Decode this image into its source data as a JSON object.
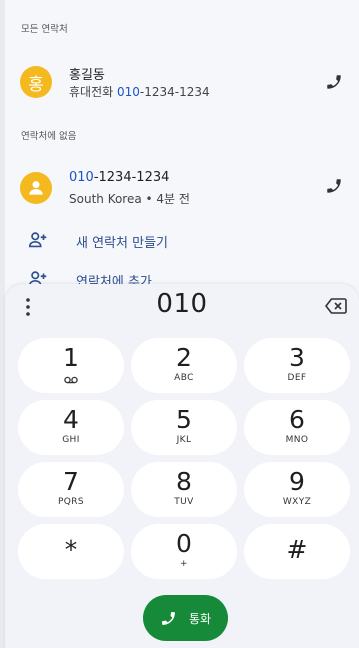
{
  "results": {
    "all_contacts_label": "모든 연락처",
    "contact": {
      "avatar_initial": "홍",
      "name": "홍길동",
      "phone_type": "휴대전화",
      "phone_match": "010",
      "phone_rest": "-1234-1234"
    },
    "not_in_contacts_label": "연락처에 없음",
    "unknown": {
      "number_match": "010",
      "number_rest": "-1234-1234",
      "detail": "South Korea • 4분 전"
    },
    "create_contact_label": "새 연락처 만들기",
    "add_to_contact_label": "연락처에 추가"
  },
  "dialpad": {
    "digits": "010",
    "keys": [
      {
        "digit": "1",
        "letters": "voicemail-icon"
      },
      {
        "digit": "2",
        "letters": "ABC"
      },
      {
        "digit": "3",
        "letters": "DEF"
      },
      {
        "digit": "4",
        "letters": "GHI"
      },
      {
        "digit": "5",
        "letters": "JKL"
      },
      {
        "digit": "6",
        "letters": "MNO"
      },
      {
        "digit": "7",
        "letters": "PQRS"
      },
      {
        "digit": "8",
        "letters": "TUV"
      },
      {
        "digit": "9",
        "letters": "WXYZ"
      },
      {
        "digit": "*",
        "letters": ""
      },
      {
        "digit": "0",
        "letters": "+"
      },
      {
        "digit": "#",
        "letters": ""
      }
    ],
    "call_label": "통화"
  },
  "colors": {
    "call_green": "#168a39",
    "avatar_yellow": "#f5b920",
    "highlight_blue": "#1a54c7"
  }
}
